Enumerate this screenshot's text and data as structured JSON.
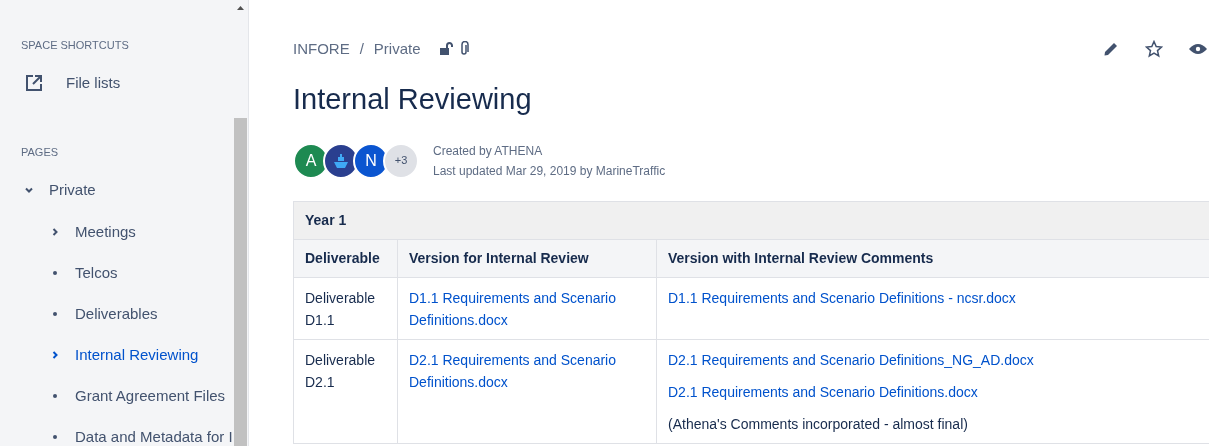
{
  "sidebar": {
    "shortcuts_heading": "SPACE SHORTCUTS",
    "shortcuts": [
      {
        "label": "File lists"
      }
    ],
    "pages_heading": "PAGES",
    "pages": [
      {
        "label": "Private",
        "kind": "branch",
        "expanded": true,
        "selected": false,
        "children": [
          {
            "label": "Meetings",
            "kind": "branch",
            "expanded": false,
            "selected": false
          },
          {
            "label": "Telcos",
            "kind": "leaf",
            "selected": false
          },
          {
            "label": "Deliverables",
            "kind": "leaf",
            "selected": false
          },
          {
            "label": "Internal Reviewing",
            "kind": "branch",
            "expanded": false,
            "selected": true
          },
          {
            "label": "Grant Agreement Files",
            "kind": "leaf",
            "selected": false
          },
          {
            "label": "Data and Metadata for I",
            "kind": "leaf",
            "selected": false
          }
        ]
      }
    ]
  },
  "breadcrumbs": [
    "INFORE",
    "Private"
  ],
  "breadcrumb_separator": "/",
  "title": "Internal Reviewing",
  "contributors": [
    {
      "kind": "letter",
      "label": "A",
      "color": "#1e8a52"
    },
    {
      "kind": "logo",
      "color": "#2a3f8f"
    },
    {
      "kind": "letter",
      "label": "N",
      "color": "#0b55d0"
    },
    {
      "kind": "count",
      "label": "+3",
      "color": "#dfe1e6"
    }
  ],
  "byline": {
    "created": "Created by ATHENA",
    "updated": "Last updated Mar 29, 2019 by MarineTraffic"
  },
  "table": {
    "section": "Year 1",
    "columns": [
      "Deliverable",
      "Version for Internal Review",
      "Version with Internal Review Comments"
    ],
    "rows": [
      [
        [
          {
            "kind": "text",
            "text": "Deliverable D1.1"
          }
        ],
        [
          {
            "kind": "link",
            "text": "D1.1 Requirements and Scenario Definitions.docx"
          }
        ],
        [
          {
            "kind": "link",
            "text": "D1.1 Requirements and Scenario Definitions - ncsr.docx"
          }
        ]
      ],
      [
        [
          {
            "kind": "text",
            "text": "Deliverable D2.1"
          }
        ],
        [
          {
            "kind": "link",
            "text": "D2.1 Requirements and Scenario Definitions.docx"
          }
        ],
        [
          {
            "kind": "link",
            "text": "D2.1 Requirements and Scenario Definitions_NG_AD.docx"
          },
          {
            "kind": "link",
            "text": "D2.1 Requirements and Scenario Definitions.docx"
          },
          {
            "kind": "text",
            "text": "(Athena's Comments incorporated - almost final)"
          }
        ]
      ]
    ]
  }
}
